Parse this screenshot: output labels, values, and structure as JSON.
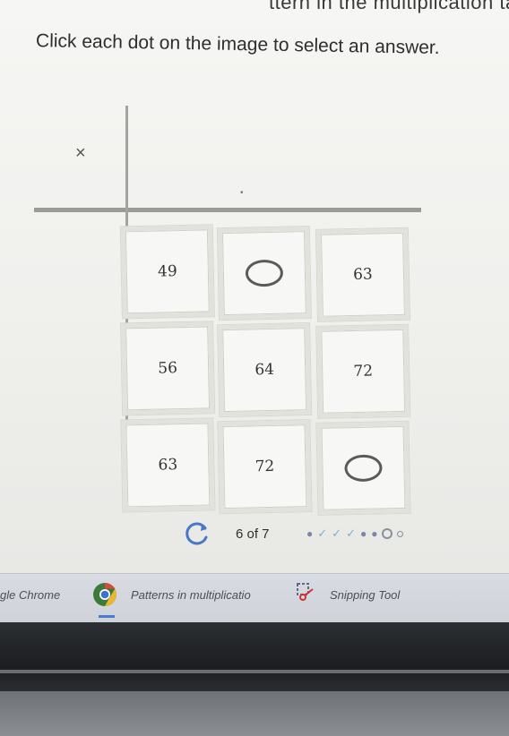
{
  "header": {
    "partial_title": "ttern in the multiplication tabl",
    "instruction": "Click each dot on the image to select an answer."
  },
  "table": {
    "operator_symbol": "×",
    "rows": [
      [
        "49",
        "",
        "63"
      ],
      [
        "56",
        "64",
        "72"
      ],
      [
        "63",
        "72",
        ""
      ]
    ],
    "answer_dot_positions": [
      "row1-col2",
      "row3-col3"
    ]
  },
  "progress": {
    "label": "6 of 7",
    "current": 6,
    "total": 7
  },
  "taskbar": {
    "items": [
      {
        "label": "gle Chrome",
        "icon": "chrome-icon"
      },
      {
        "label": "Patterns in multiplicatio",
        "icon": "chrome-icon"
      },
      {
        "label": "Snipping Tool",
        "icon": "scissors-icon"
      }
    ]
  },
  "colors": {
    "background": "#efefec",
    "cell_border": "#e2e2dc",
    "taskbar": "#d3d7dd",
    "progress_dots": "#8aa7d6"
  }
}
